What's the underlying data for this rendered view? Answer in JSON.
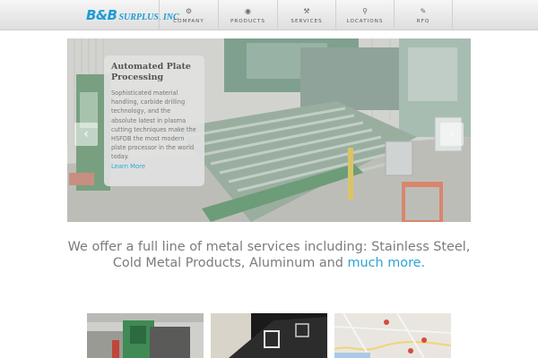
{
  "header": {
    "logo_bb": "B&B",
    "logo_rest": "SURPLUS, INC",
    "nav": [
      {
        "label": "COMPANY",
        "icon": "gear-icon",
        "glyph": "⚙"
      },
      {
        "label": "PRODUCTS",
        "icon": "target-icon",
        "glyph": "◉"
      },
      {
        "label": "SERVICES",
        "icon": "tools-icon",
        "glyph": "⚒"
      },
      {
        "label": "LOCATIONS",
        "icon": "map-pin-icon",
        "glyph": "⚲"
      },
      {
        "label": "RFQ",
        "icon": "document-icon",
        "glyph": "✎"
      }
    ]
  },
  "slider": {
    "prev": "‹",
    "next": "›",
    "caption": {
      "title": "Automated Plate Processing",
      "body": "Sophisticated material handling, carbide drilling technology, and the absolute latest in plasma cutting techniques make the HSFDB the most modern plate processor in the world today.",
      "link": "Learn More"
    }
  },
  "tagline": {
    "text": "We offer a full line of metal services including: Stainless Steel, Cold Metal Products, Aluminum and ",
    "link": "much more."
  },
  "colors": {
    "accent": "#1e9bd7",
    "link": "#2aa3d6",
    "machine_green": "#5ea070"
  }
}
